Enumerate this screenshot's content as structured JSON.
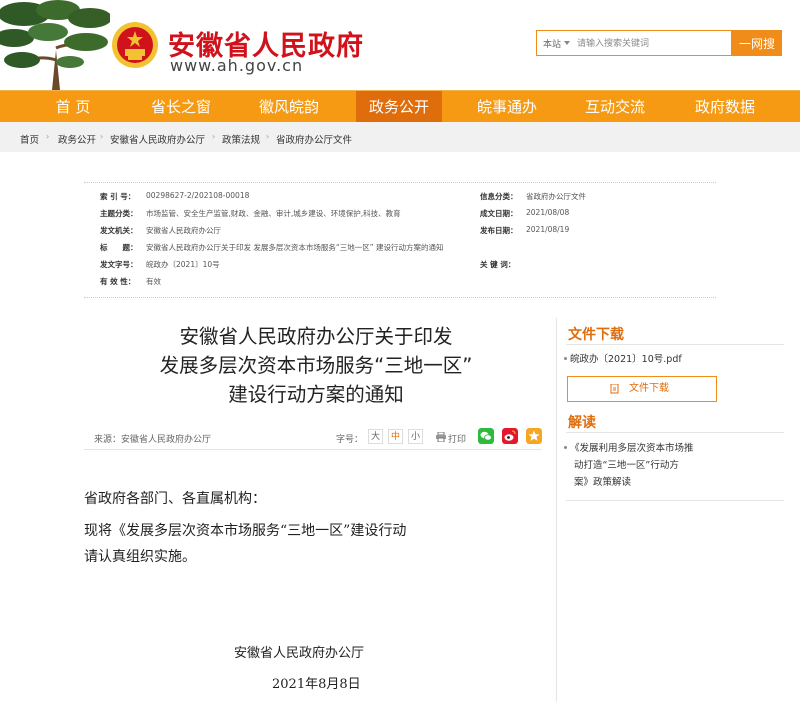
{
  "header": {
    "site_title": "安徽省人民政府",
    "site_url": "www.ah.gov.cn",
    "search_scope": "本站",
    "search_placeholder": "请输入搜索关键词",
    "search_button": "一网搜"
  },
  "nav": {
    "items": [
      {
        "label": "首 页"
      },
      {
        "label": "省长之窗"
      },
      {
        "label": "徽风皖韵"
      },
      {
        "label": "政务公开"
      },
      {
        "label": "皖事通办"
      },
      {
        "label": "互动交流"
      },
      {
        "label": "政府数据"
      }
    ],
    "active_index": 3
  },
  "breadcrumb": [
    "首页",
    "政务公开",
    "安徽省人民政府办公厅",
    "政策法规",
    "省政府办公厅文件"
  ],
  "meta": {
    "index_label": "索 引 号：",
    "index_value": "00298627-2/202108-00018",
    "category_label": "信息分类：",
    "category_value": "省政府办公厅文件",
    "topic_label": "主题分类：",
    "topic_value": "市场监管、安全生产监管,财政、金融、审计,城乡建设、环境保护,科技、教育",
    "created_label": "成文日期：",
    "created_value": "2021/08/08",
    "issuer_label": "发文机关：",
    "issuer_value": "安徽省人民政府办公厅",
    "published_label": "发布日期：",
    "published_value": "2021/08/19",
    "title_label": "标　　题：",
    "title_value": "安徽省人民政府办公厅关于印发 发展多层次资本市场服务“三地一区” 建设行动方案的通知",
    "docno_label": "发文字号：",
    "docno_value": "皖政办〔2021〕10号",
    "keywords_label": "关 键 词：",
    "keywords_value": "",
    "validity_label": "有 效 性：",
    "validity_value": "有效"
  },
  "article": {
    "title_lines": [
      "安徽省人民政府办公厅关于印发",
      "发展多层次资本市场服务“三地一区”",
      "建设行动方案的通知"
    ],
    "source": "来源：安徽省人民政府办公厅",
    "font_size_label": "字号：",
    "font_sizes": [
      "大",
      "中",
      "小"
    ],
    "print_label": "打印",
    "body_lines": [
      "省政府各部门、各直属机构：",
      "现将《发展多层次资本市场服务“三地一区”建设行动",
      "请认真组织实施。"
    ],
    "signature": "安徽省人民政府办公厅",
    "date": "2021年8月8日"
  },
  "sidebar": {
    "download_title": "文件下载",
    "file_name": "皖政办〔2021〕10号.pdf",
    "download_button": "文件下载",
    "interpret_title": "解读",
    "interpret_item_lines": [
      "《发展利用多层次资本市场推",
      "动打造“三地一区”行动方",
      "案》政策解读"
    ]
  },
  "colors": {
    "brand_red": "#d0121b",
    "nav_orange": "#f59a12",
    "nav_active": "#e06d0c",
    "accent": "#f08c1a",
    "wechat_green": "#2dbb3d",
    "weibo_red": "#e6162d",
    "favorite_orange": "#f5a623"
  }
}
